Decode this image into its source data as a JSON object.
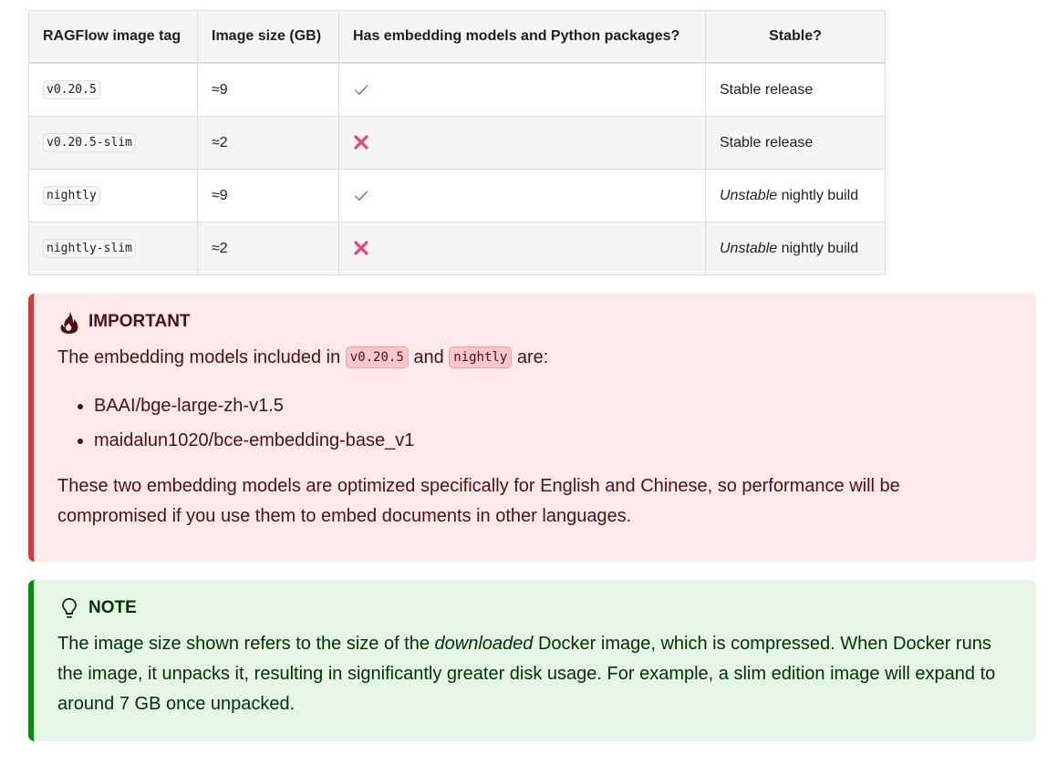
{
  "table": {
    "headers": [
      "RAGFlow image tag",
      "Image size (GB)",
      "Has embedding models and Python packages?",
      "Stable?"
    ],
    "rows": [
      {
        "tag": "v0.20.5",
        "size": "≈9",
        "has_embedding": true,
        "stable_emph": "",
        "stable_rest": "Stable release"
      },
      {
        "tag": "v0.20.5-slim",
        "size": "≈2",
        "has_embedding": false,
        "stable_emph": "",
        "stable_rest": "Stable release"
      },
      {
        "tag": "nightly",
        "size": "≈9",
        "has_embedding": true,
        "stable_emph": "Unstable",
        "stable_rest": " nightly build"
      },
      {
        "tag": "nightly-slim",
        "size": "≈2",
        "has_embedding": false,
        "stable_emph": "Unstable",
        "stable_rest": " nightly build"
      }
    ]
  },
  "important": {
    "title": "IMPORTANT",
    "intro_before": "The embedding models included in ",
    "intro_code1": "v0.20.5",
    "intro_mid": " and ",
    "intro_code2": "nightly",
    "intro_after": " are:",
    "models": [
      "BAAI/bge-large-zh-v1.5",
      "maidalun1020/bce-embedding-base_v1"
    ],
    "body": "These two embedding models are optimized specifically for English and Chinese, so performance will be compromised if you use them to embed documents in other languages."
  },
  "note": {
    "title": "NOTE",
    "text_before": "The image size shown refers to the size of the ",
    "text_emph": "downloaded",
    "text_after": " Docker image, which is compressed. When Docker runs the image, it unpacks it, resulting in significantly greater disk usage. For example, a slim edition image will expand to around 7 GB once unpacked."
  },
  "colors": {
    "check": "#7b5cc4",
    "cross": "#e8466e",
    "important_border": "#e13238",
    "important_bg": "#fde9ea",
    "note_border": "#009400",
    "note_bg": "#e6f6e6"
  },
  "icons": {
    "check": "check-mark-icon",
    "cross": "cross-mark-icon",
    "important": "fire-icon",
    "note": "lightbulb-icon"
  }
}
